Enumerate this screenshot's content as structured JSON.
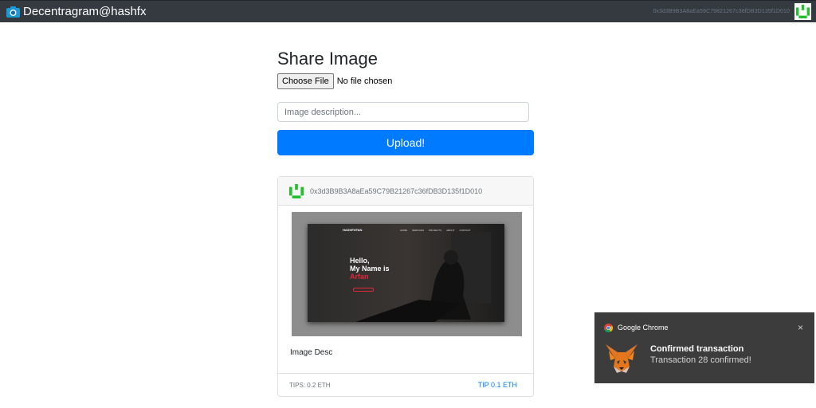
{
  "navbar": {
    "brand": "Decentragram@hashfx",
    "account": "0x3d3B9B3A8aEa59C79821267c36fDB3D135f1D010"
  },
  "form": {
    "title": "Share Image",
    "file_button": "Choose File",
    "file_status": "No file chosen",
    "description_placeholder": "Image description...",
    "upload_label": "Upload!"
  },
  "post": {
    "author": "0x3d3B9B3A8aEa59C79B21267c36fDB3D135f1D010",
    "caption": "Image Desc",
    "image_text": {
      "logo": "HASHFXFAN",
      "nav": [
        "HOME",
        "SERVICES",
        "PROJECTS",
        "ABOUT",
        "CONTACT"
      ],
      "greeting_1": "Hello,",
      "greeting_2": "My Name is",
      "name": "Arfan"
    },
    "tips": "TIPS: 0.2 ETH",
    "tip_action": "TIP 0.1 ETH"
  },
  "notification": {
    "app": "Google Chrome",
    "title": "Confirmed transaction",
    "message": "Transaction 28 confirmed!",
    "close_icon": "×"
  },
  "colors": {
    "navbar": "#343a40",
    "primary": "#007bff",
    "identicon": "#22c02a",
    "toast_bg": "#3c3c3c",
    "accent_red": "#e0283a"
  }
}
